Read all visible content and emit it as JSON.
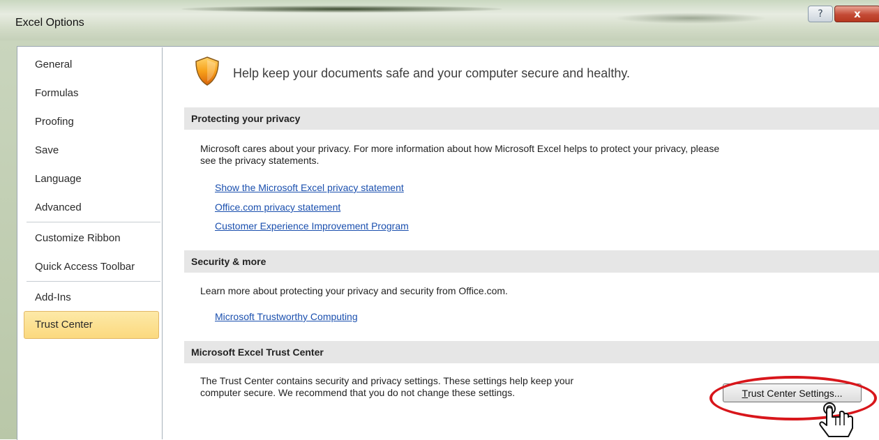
{
  "window": {
    "title": "Excel Options",
    "help_glyph": "?",
    "close_glyph": "x"
  },
  "sidebar": {
    "items": [
      {
        "label": "General"
      },
      {
        "label": "Formulas"
      },
      {
        "label": "Proofing"
      },
      {
        "label": "Save"
      },
      {
        "label": "Language"
      },
      {
        "label": "Advanced"
      },
      {
        "label": "Customize Ribbon"
      },
      {
        "label": "Quick Access Toolbar"
      },
      {
        "label": "Add-Ins"
      },
      {
        "label": "Trust Center"
      }
    ],
    "selected": "Trust Center"
  },
  "main": {
    "headline": "Help keep your documents safe and your computer secure and healthy.",
    "sections": [
      {
        "title": "Protecting your privacy",
        "text_line1": "Microsoft cares about your privacy. For more information about how Microsoft Excel helps to protect your privacy, please",
        "text_line2": "see the privacy statements.",
        "links": [
          "Show the Microsoft Excel privacy statement",
          "Office.com privacy statement",
          "Customer Experience Improvement Program"
        ]
      },
      {
        "title": "Security & more",
        "text": "Learn more about protecting your privacy and security from Office.com.",
        "links": [
          "Microsoft Trustworthy Computing"
        ]
      },
      {
        "title": "Microsoft Excel Trust Center",
        "text_line1": "The Trust Center contains security and privacy settings. These settings help keep your",
        "text_line2": "computer secure. We recommend that you do not change these settings.",
        "button": {
          "accel": "T",
          "rest": "rust Center Settings..."
        }
      }
    ]
  },
  "colors": {
    "annotation": "#d8161b",
    "selected_item": "#fbd97e",
    "link": "#1a4fae",
    "close_button": "#c44a35"
  },
  "icons": [
    "shield-icon",
    "help-icon",
    "close-icon",
    "pointing-hand-icon"
  ]
}
